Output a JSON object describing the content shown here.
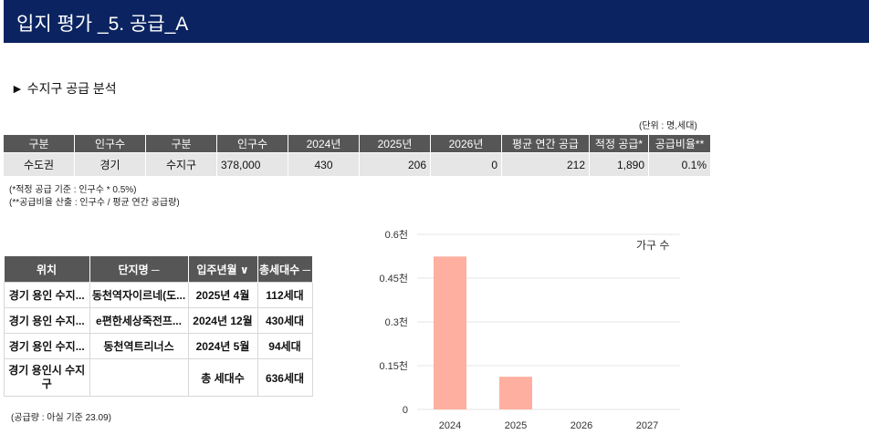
{
  "header": {
    "title": "입지 평가 _5. 공급_A"
  },
  "section": {
    "title": "► 수지구 공급 분석",
    "unit_note": "(단위 : 명,세대)"
  },
  "supply_table": {
    "headers": [
      "구분",
      "인구수",
      "구분",
      "인구수",
      "2024년",
      "2025년",
      "2026년",
      "평균 연간 공급",
      "적정 공급*",
      "공급비율**"
    ],
    "row": [
      "수도권",
      "경기",
      "수지구",
      "378,000",
      "430",
      "206",
      "0",
      "212",
      "1,890",
      "0.1%"
    ]
  },
  "footnotes": {
    "note1": "(*적정 공급 기준 : 인구수 * 0.5%)",
    "note2": "(**공급비율 산출 : 인구수 / 평균 연간 공급량)",
    "note3": "(공급량 : 아실 기준 23.09)"
  },
  "complex_table": {
    "headers": [
      "위치",
      "단지명 ─",
      "입주년월 ∨",
      "총세대수 ─"
    ],
    "rows": [
      [
        "경기 용인 수지...",
        "동천역자이르네(도...",
        "2025년 4월",
        "112세대"
      ],
      [
        "경기 용인 수지...",
        "e편한세상죽전프...",
        "2024년 12월",
        "430세대"
      ],
      [
        "경기 용인 수지...",
        "동천역트리너스",
        "2024년 5월",
        "94세대"
      ],
      [
        "경기 용인시 수지구",
        "",
        "총 세대수",
        "636세대"
      ]
    ]
  },
  "chart_data": {
    "type": "bar",
    "legend": "가구 수",
    "categories": [
      "2024",
      "2025",
      "2026",
      "2027"
    ],
    "values": [
      524,
      112,
      0,
      0
    ],
    "ylim": [
      0,
      600
    ],
    "yticks": [
      0,
      150,
      300,
      450,
      600
    ],
    "ytick_labels": [
      "0",
      "0.15천",
      "0.3천",
      "0.45천",
      "0.6천"
    ],
    "bar_color": "#ffaf9f",
    "grid": true
  }
}
